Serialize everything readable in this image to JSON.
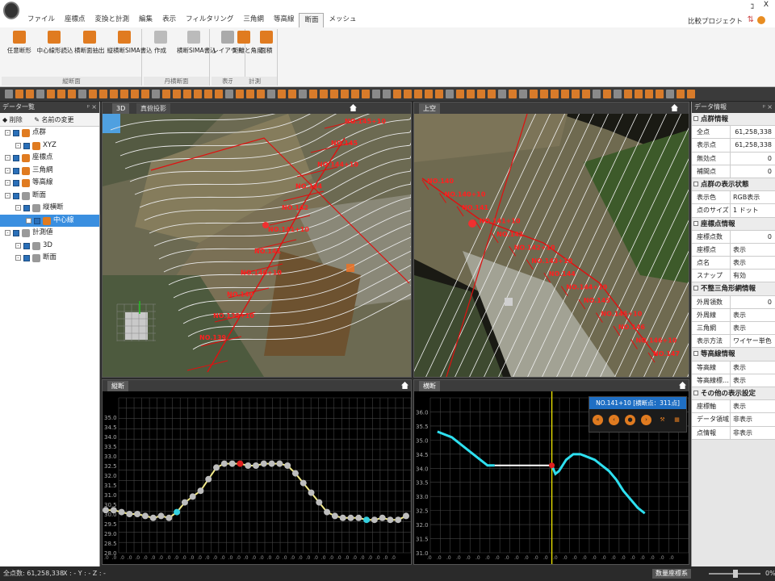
{
  "app": {
    "project": "比較プロジェクト",
    "win_min": "ｺ",
    "win_close": "X"
  },
  "tabs": [
    "ファイル",
    "座標点",
    "変換と計測",
    "編集",
    "表示",
    "フィルタリング",
    "三角網",
    "等高線",
    "断面",
    "メッシュ"
  ],
  "active_tab": 8,
  "ribbon": {
    "groups": [
      {
        "label": "縦断面",
        "buttons": [
          "任意断形",
          "中心線形読込",
          "横断面抽出",
          "縦横断SIMA書込"
        ]
      },
      {
        "label": "丹横断面",
        "buttons": [
          "作成",
          "横断SIMA書込"
        ]
      },
      {
        "label": "表示",
        "buttons": [
          "レイアウト"
        ]
      },
      {
        "label": "計測",
        "buttons": [
          "距離と角度",
          "面積"
        ]
      }
    ]
  },
  "left_panel": {
    "title": "データ一覧",
    "tool_delete": "削除",
    "tool_rename": "名前の変更",
    "tree": [
      {
        "label": "点群",
        "level": 0,
        "icon": "orange"
      },
      {
        "label": "XYZ",
        "level": 1,
        "icon": "orange"
      },
      {
        "label": "座標点",
        "level": 0,
        "icon": "orange"
      },
      {
        "label": "三角網",
        "level": 0,
        "icon": "orange"
      },
      {
        "label": "等高線",
        "level": 0,
        "icon": "orange"
      },
      {
        "label": "断面",
        "level": 0,
        "icon": "gray"
      },
      {
        "label": "縦横断",
        "level": 1,
        "icon": "gray"
      },
      {
        "label": "中心線",
        "level": 2,
        "icon": "orange",
        "selected": true
      },
      {
        "label": "計測値",
        "level": 0,
        "icon": "gray"
      },
      {
        "label": "3D",
        "level": 1,
        "icon": "gray"
      },
      {
        "label": "断面",
        "level": 1,
        "icon": "gray"
      }
    ]
  },
  "right_panel": {
    "title": "データ情報",
    "sections": [
      {
        "title": "点群情報",
        "rows": [
          [
            "全点",
            "61,258,338"
          ],
          [
            "表示点",
            "61,258,338"
          ],
          [
            "無効点",
            "0"
          ],
          [
            "補間点",
            "0"
          ]
        ]
      },
      {
        "title": "点群の表示状態",
        "rows": [
          [
            "表示色",
            "RGB表示"
          ],
          [
            "点のサイズ",
            "1 ドット"
          ]
        ]
      },
      {
        "title": "座標点情報",
        "rows": [
          [
            "座標点数",
            "0"
          ],
          [
            "座標点",
            "表示"
          ],
          [
            "点名",
            "表示"
          ],
          [
            "スナップ",
            "有効"
          ]
        ]
      },
      {
        "title": "不整三角形網情報",
        "rows": [
          [
            "外周領数",
            "0"
          ],
          [
            "外周線",
            "表示"
          ],
          [
            "三角網",
            "表示"
          ],
          [
            "表示方法",
            "ワイヤー単色"
          ]
        ]
      },
      {
        "title": "等高線情報",
        "rows": [
          [
            "等高線",
            "表示"
          ],
          [
            "等高線標…",
            "表示"
          ]
        ]
      },
      {
        "title": "その他の表示設定",
        "rows": [
          [
            "座標軸",
            "表示"
          ],
          [
            "データ領域",
            "非表示"
          ],
          [
            "点情報",
            "非表示"
          ]
        ]
      }
    ]
  },
  "views": {
    "v3d": {
      "tab1": "3D",
      "tab2": "真俯投影",
      "stations": [
        "NO.145+10",
        "NO.145",
        "NO.144+10",
        "NO.144",
        "NO.142",
        "NO.141+10",
        "NO.141",
        "NO.140+10",
        "NO.140",
        "NO.139+10",
        "NO.139"
      ]
    },
    "vtop": {
      "tab": "上空",
      "stations": [
        "NO.140",
        "NO.140+10",
        "NO.141",
        "NO.141+10",
        "NO.142",
        "NO.142+10",
        "NO.143+10",
        "NO.144",
        "NO.144+10",
        "NO.145",
        "NO.145+10",
        "NO.146",
        "NO.146+10",
        "NO.147"
      ]
    },
    "vlong": {
      "tab": "縦断"
    },
    "vcross": {
      "tab": "横断",
      "info_title": "NO.141+10 [横断点：311点]"
    }
  },
  "chart_data": [
    {
      "type": "line",
      "title": "縦断",
      "ylim": [
        28.0,
        36.0
      ],
      "yticks": [
        "35.0",
        "34.5",
        "34.0",
        "33.5",
        "33.0",
        "32.5",
        "32.0",
        "31.5",
        "31.0",
        "30.5",
        "30.0",
        "29.5",
        "29.0",
        "28.5",
        "28.0"
      ],
      "series": [
        {
          "values": [
            30.2,
            30.2,
            30.1,
            30.0,
            30.0,
            29.9,
            29.8,
            29.9,
            29.8,
            30.1,
            30.6,
            30.9,
            31.2,
            31.8,
            32.4,
            32.6,
            32.6,
            32.6,
            32.5,
            32.5,
            32.6,
            32.6,
            32.6,
            32.5,
            32.1,
            31.6,
            31.1,
            30.6,
            30.1,
            29.9,
            29.8,
            29.8,
            29.8,
            29.7,
            29.7,
            29.8,
            29.7,
            29.7,
            29.9
          ]
        }
      ]
    },
    {
      "type": "line",
      "title": "横断",
      "ylim": [
        31.0,
        36.5
      ],
      "yticks": [
        "36.0",
        "35.5",
        "35.0",
        "34.5",
        "34.0",
        "33.5",
        "33.0",
        "32.5",
        "32.0",
        "31.5",
        "31.0"
      ],
      "x": [
        -16.0,
        -15.0,
        -14.0,
        -13.0,
        -12.0,
        -11.0,
        -10.0,
        -9.0,
        -8.0,
        -7.0,
        -6.0,
        -5.0,
        -4.0,
        -3.0,
        -2.0,
        -1.0,
        0.0,
        0.5,
        1.0,
        2.0,
        3.0,
        4.0,
        5.0,
        6.0,
        7.0,
        8.0,
        9.0,
        10.0,
        11.0,
        12.0,
        13.0
      ],
      "series": [
        {
          "values": [
            35.3,
            35.2,
            35.1,
            34.9,
            34.7,
            34.5,
            34.3,
            34.1,
            34.1,
            34.1,
            34.1,
            34.1,
            34.1,
            34.1,
            34.1,
            34.1,
            34.1,
            33.8,
            33.9,
            34.3,
            34.5,
            34.5,
            34.4,
            34.3,
            34.1,
            33.9,
            33.6,
            33.2,
            32.9,
            32.6,
            32.4
          ]
        }
      ]
    }
  ],
  "status": {
    "count": "全点数: 61,258,338",
    "xyz": "X : -  Y : -  Z : -",
    "coord": "数量座標系",
    "zoom": "0%"
  }
}
